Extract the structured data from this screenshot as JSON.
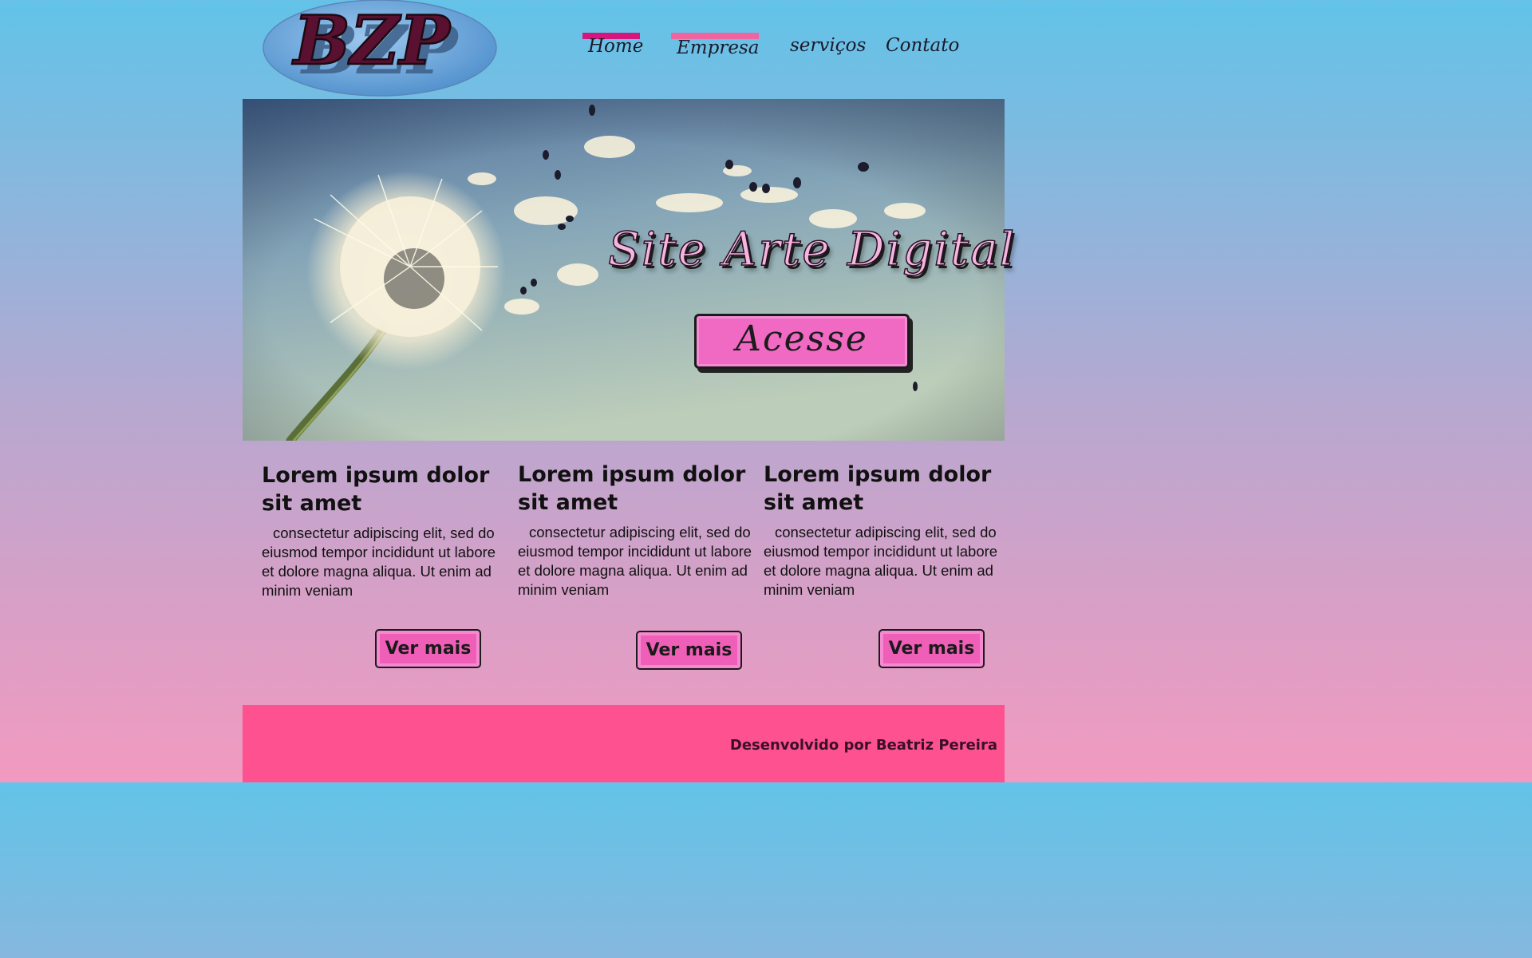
{
  "logo": {
    "text": "BZP"
  },
  "nav": {
    "items": [
      {
        "label": "Home",
        "active": true
      },
      {
        "label": "Empresa",
        "active": false
      },
      {
        "label": "serviços",
        "active": false
      },
      {
        "label": "Contato",
        "active": false
      }
    ]
  },
  "hero": {
    "title": "Site Arte Digital",
    "button_label": "Acesse"
  },
  "cards": [
    {
      "title": "Lorem ipsum dolor sit amet",
      "body": "consectetur adipiscing elit, sed do eiusmod tempor incididunt ut labore et dolore magna aliqua. Ut enim ad minim veniam",
      "button_label": "Ver mais"
    },
    {
      "title": "Lorem ipsum dolor sit amet",
      "body": "consectetur adipiscing elit, sed do eiusmod tempor incididunt ut labore et dolore magna aliqua. Ut enim ad minim veniam",
      "button_label": "Ver mais"
    },
    {
      "title": "Lorem ipsum dolor sit amet",
      "body": "consectetur adipiscing elit, sed do eiusmod tempor incididunt ut labore et dolore magna aliqua. Ut enim ad minim veniam",
      "button_label": "Ver mais"
    }
  ],
  "footer": {
    "text": "Desenvolvido por Beatriz Pereira"
  },
  "colors": {
    "accent_pink": "#f06ac3",
    "nav_active": "#d6157e",
    "nav_bar": "#f0649f",
    "footer_bg": "#fd528f"
  }
}
